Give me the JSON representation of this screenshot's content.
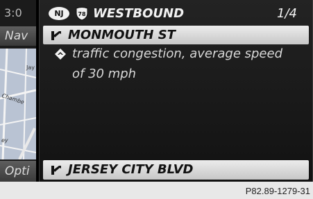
{
  "sidebar": {
    "time": "3:0",
    "nav_label": "Nav",
    "options_label": "Opti",
    "map_labels": [
      "Jay",
      "Chambe",
      "ey"
    ]
  },
  "header": {
    "state_badge": "NJ",
    "route_number": "78",
    "title": "WESTBOUND",
    "page": "1/4"
  },
  "traffic": {
    "selected_street": "MONMOUTH ST",
    "message_line1": "traffic congestion, average speed",
    "message_line2": "of 30 mph",
    "next_street": "JERSEY CITY BLVD"
  },
  "caption": "P82.89-1279-31",
  "icons": {
    "street_icon": "turn-arrow-icon",
    "message_icon": "traffic-warning-icon",
    "route_icon": "interstate-shield-icon"
  },
  "colors": {
    "screen_bg": "#000000",
    "selected_row": "#e2e2e2",
    "text_light": "#f2f2f2",
    "map_bg": "#b9c3d3"
  }
}
